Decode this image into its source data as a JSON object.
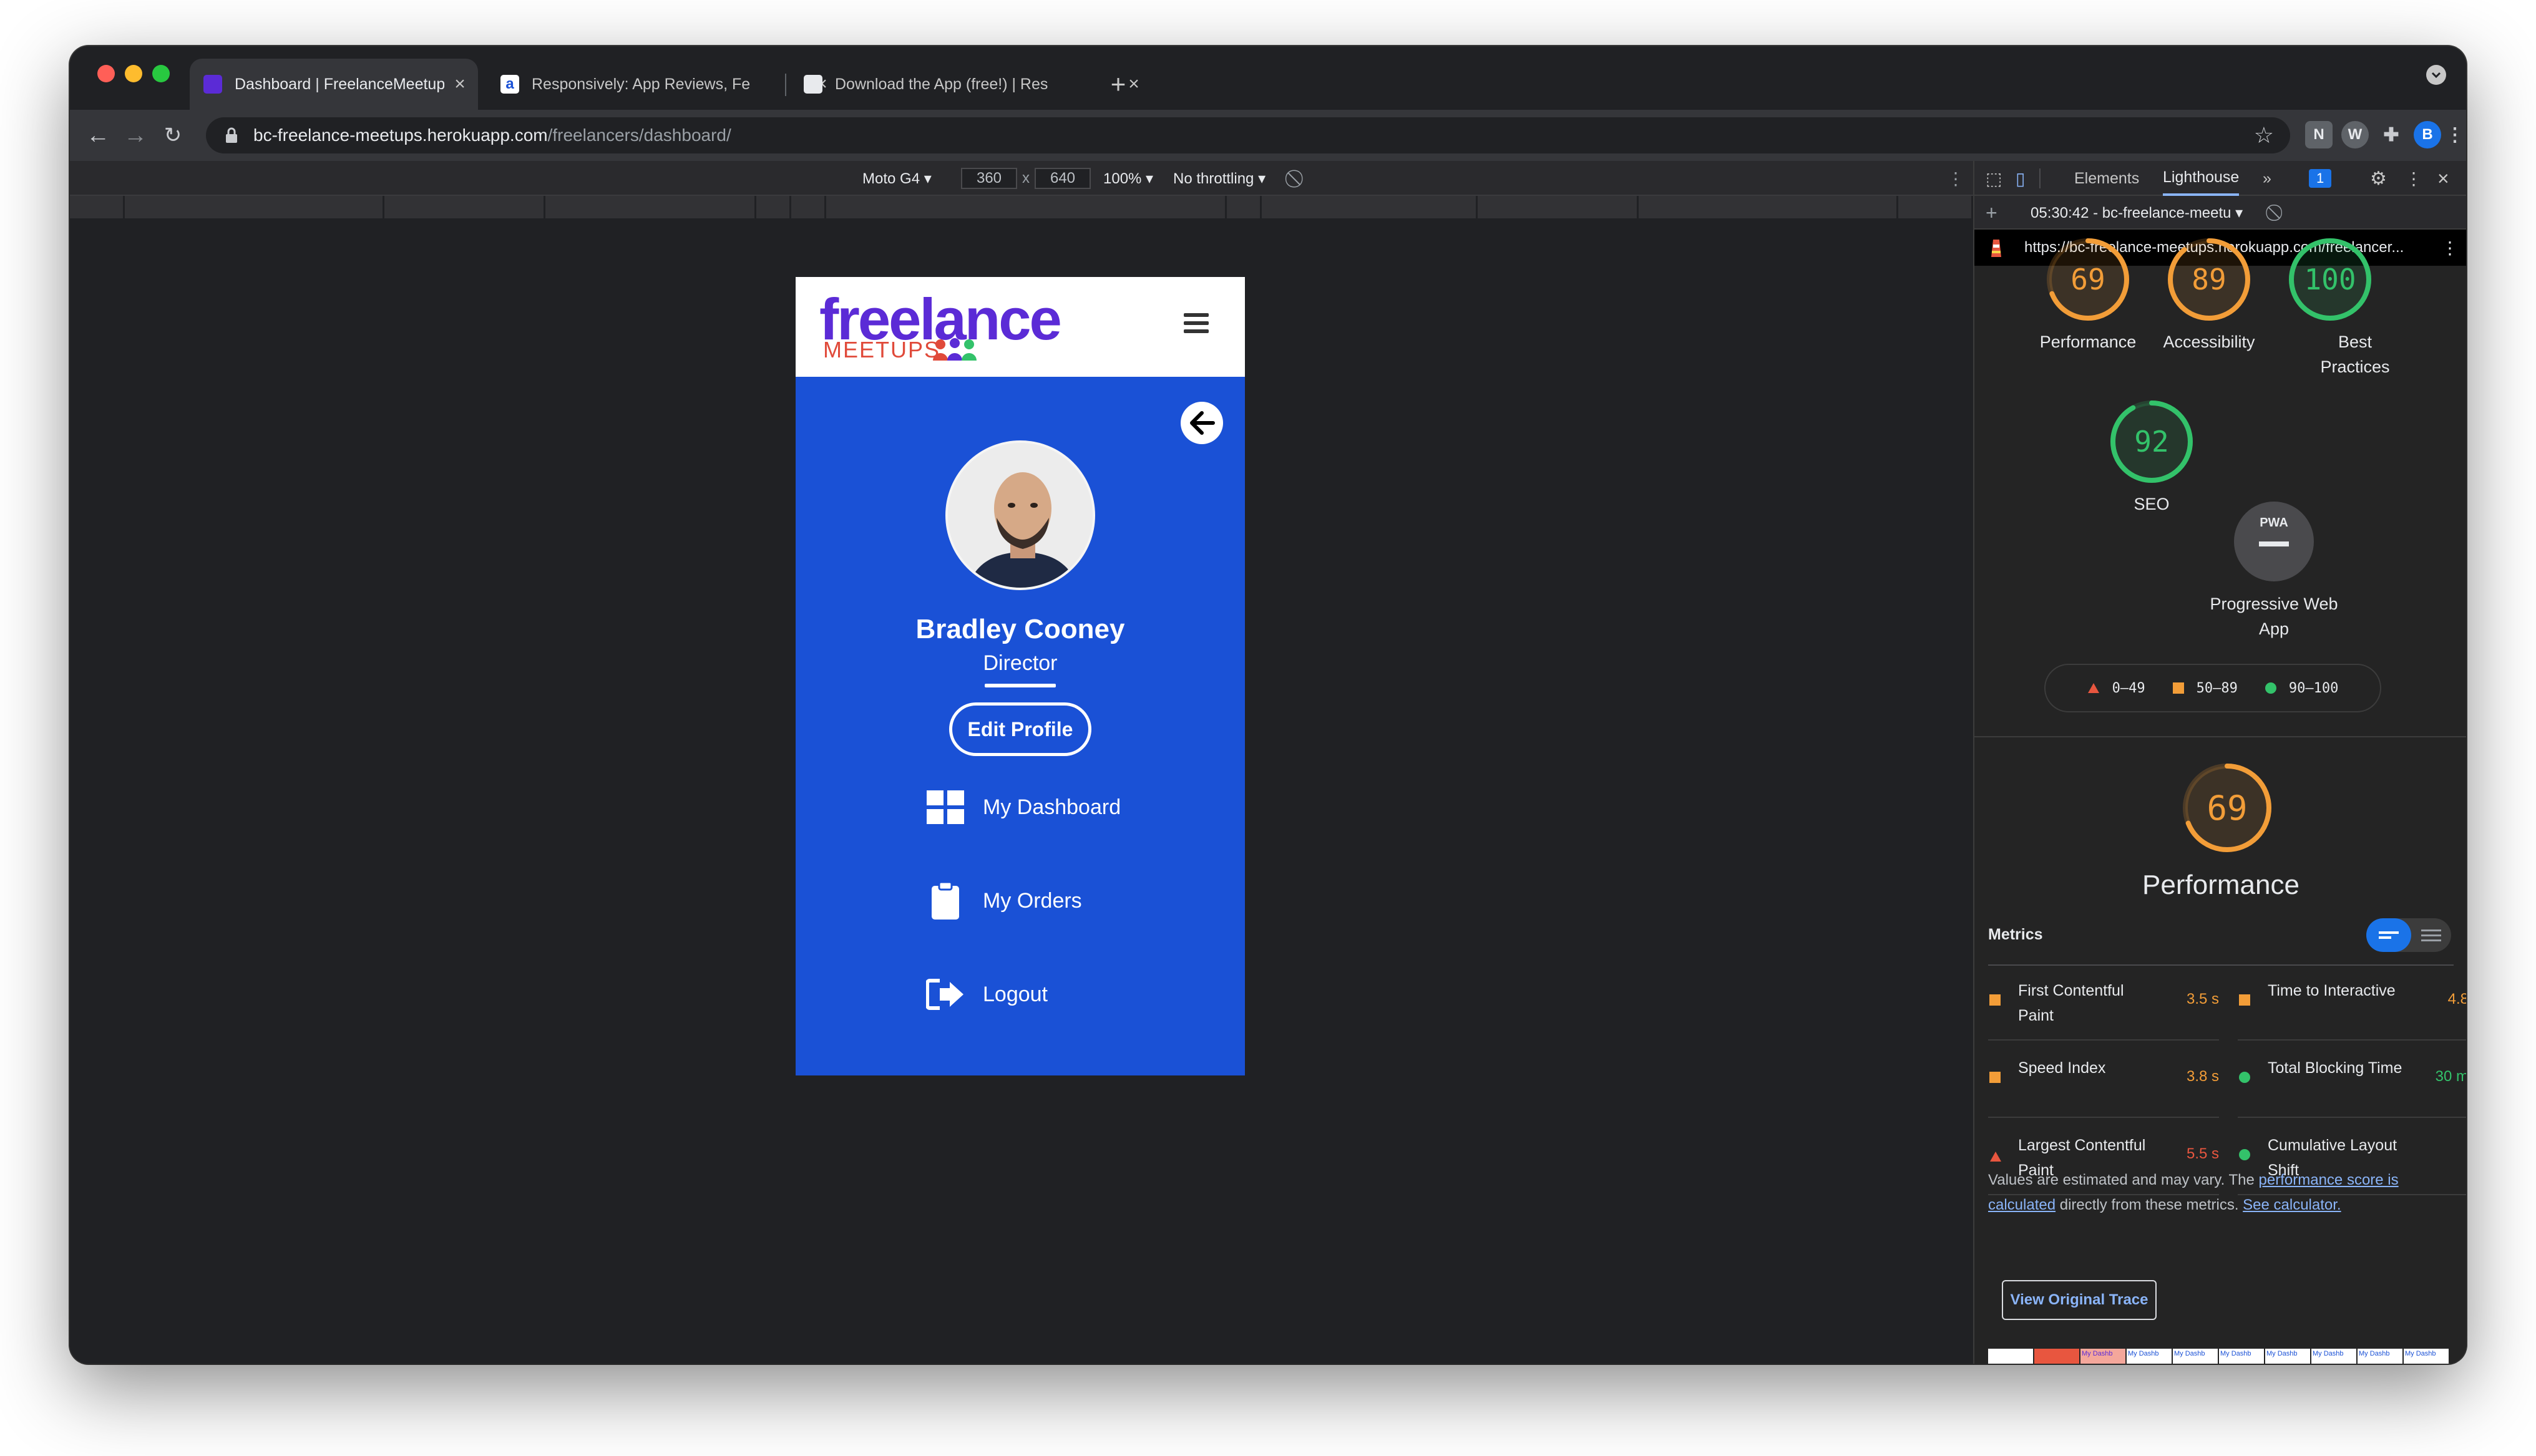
{
  "tabs": [
    {
      "title": "Dashboard | FreelanceMeetups",
      "active": true
    },
    {
      "title": "Responsively: App Reviews, Fe",
      "active": false
    },
    {
      "title": "Download the App (free!) | Res",
      "active": false
    }
  ],
  "new_tab": "+",
  "address": {
    "host": "bc-freelance-meetups.herokuapp.com",
    "path": "/freelancers/dashboard/"
  },
  "profile_initial": "B",
  "device_toolbar": {
    "device": "Moto G4 ▾",
    "width": "360",
    "times": "x",
    "height": "640",
    "zoom": "100% ▾",
    "throttling": "No throttling ▾"
  },
  "app": {
    "logo_main": "freelance",
    "logo_sub": "MEETUPS",
    "user_name": "Bradley Cooney",
    "user_role": "Director",
    "edit_profile": "Edit Profile",
    "menu": [
      {
        "label": "My Dashboard",
        "icon": "dashboard-icon"
      },
      {
        "label": "My Orders",
        "icon": "clipboard-icon"
      },
      {
        "label": "Logout",
        "icon": "logout-icon"
      }
    ]
  },
  "devtools": {
    "tabs": [
      "Elements",
      "Lighthouse"
    ],
    "more": "»",
    "issues_count": "1",
    "report_select": "05:30:42 - bc-freelance-meetu ▾",
    "report_url": "https://bc-freelance-meetups.herokuapp.com/freelancer...",
    "scores": [
      {
        "label": "Performance",
        "value": 69,
        "color": "#f29d38"
      },
      {
        "label": "Accessibility",
        "value": 89,
        "color": "#f29d38"
      },
      {
        "label": "Best Practices",
        "value": 100,
        "color": "#33c26a"
      },
      {
        "label": "SEO",
        "value": 92,
        "color": "#33c26a"
      }
    ],
    "pwa": {
      "label": "Progressive Web App",
      "badge": "PWA"
    },
    "legend": [
      "0–49",
      "50–89",
      "90–100"
    ],
    "perf_title": "Performance",
    "perf_score": 69,
    "metrics_title": "Metrics",
    "metrics": [
      {
        "name": "First Contentful Paint",
        "value": "3.5 s",
        "status": "average"
      },
      {
        "name": "Time to Interactive",
        "value": "4.8",
        "status": "average"
      },
      {
        "name": "Speed Index",
        "value": "3.8 s",
        "status": "average"
      },
      {
        "name": "Total Blocking Time",
        "value": "30 m",
        "status": "pass"
      },
      {
        "name": "Largest Contentful Paint",
        "value": "5.5 s",
        "status": "fail"
      },
      {
        "name": "Cumulative Layout Shift",
        "value": "",
        "status": "pass"
      }
    ],
    "note_prefix": "Values are estimated and may vary. The ",
    "note_link1": "performance score is calculated",
    "note_middle": " directly from these metrics. ",
    "note_link2": "See calculator.",
    "view_trace": "View Original Trace",
    "thumb_caption": "My Dashb"
  },
  "colors": {
    "app_blue": "#1a51d6",
    "average": "#f29d38",
    "pass": "#33c26a",
    "fail": "#e8563f",
    "link": "#8ab4f8"
  }
}
